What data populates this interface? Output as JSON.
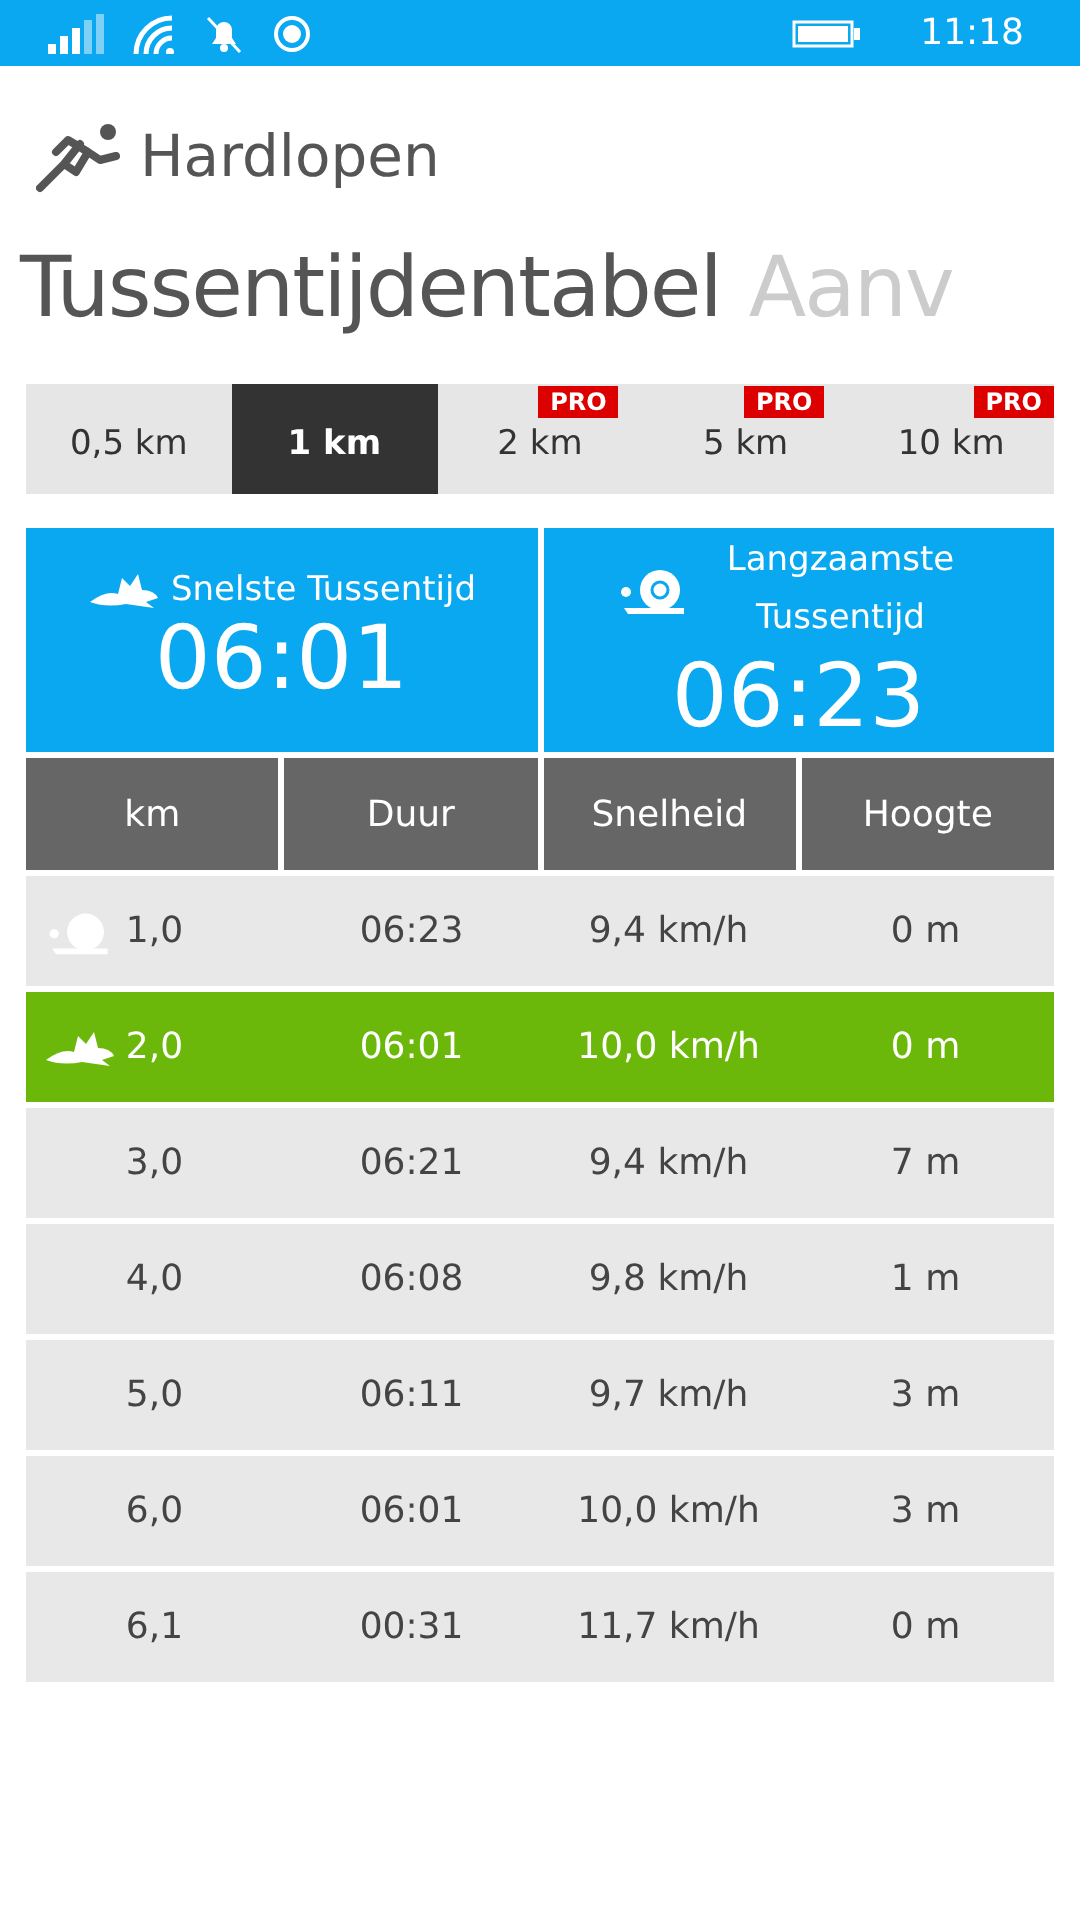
{
  "status_bar": {
    "time": "11:18"
  },
  "app": {
    "title": "Hardlopen"
  },
  "pivot": [
    {
      "label": "Tussentijdentabel",
      "selected": true
    },
    {
      "label": "Aanv",
      "selected": false
    }
  ],
  "tabs": [
    {
      "label": "0,5 km",
      "selected": false,
      "pro": false
    },
    {
      "label": "1 km",
      "selected": true,
      "pro": false
    },
    {
      "label": "2 km",
      "selected": false,
      "pro": true,
      "badge": "PRO"
    },
    {
      "label": "5 km",
      "selected": false,
      "pro": true,
      "badge": "PRO"
    },
    {
      "label": "10 km",
      "selected": false,
      "pro": true,
      "badge": "PRO"
    }
  ],
  "summary": [
    {
      "kind": "fastest",
      "label": "Snelste Tussentijd",
      "value": "06:01"
    },
    {
      "kind": "slowest",
      "label": "Langzaamste Tussentijd",
      "value": "06:23"
    }
  ],
  "table": {
    "columns": [
      "km",
      "Duur",
      "Snelheid",
      "Hoogte"
    ],
    "rows": [
      {
        "kind": "slowest",
        "highlighted": false,
        "cells": [
          "1,0",
          "06:23",
          "9,4 km/h",
          "0 m"
        ]
      },
      {
        "kind": "fastest",
        "highlighted": true,
        "cells": [
          "2,0",
          "06:01",
          "10,0 km/h",
          "0 m"
        ]
      },
      {
        "kind": "plain",
        "highlighted": false,
        "cells": [
          "3,0",
          "06:21",
          "9,4 km/h",
          "7 m"
        ]
      },
      {
        "kind": "plain",
        "highlighted": false,
        "cells": [
          "4,0",
          "06:08",
          "9,8 km/h",
          "1 m"
        ]
      },
      {
        "kind": "plain",
        "highlighted": false,
        "cells": [
          "5,0",
          "06:11",
          "9,7 km/h",
          "3 m"
        ]
      },
      {
        "kind": "plain",
        "highlighted": false,
        "cells": [
          "6,0",
          "06:01",
          "10,0 km/h",
          "3 m"
        ]
      },
      {
        "kind": "plain",
        "highlighted": false,
        "cells": [
          "6,1",
          "00:31",
          "11,7 km/h",
          "0 m"
        ]
      }
    ]
  }
}
